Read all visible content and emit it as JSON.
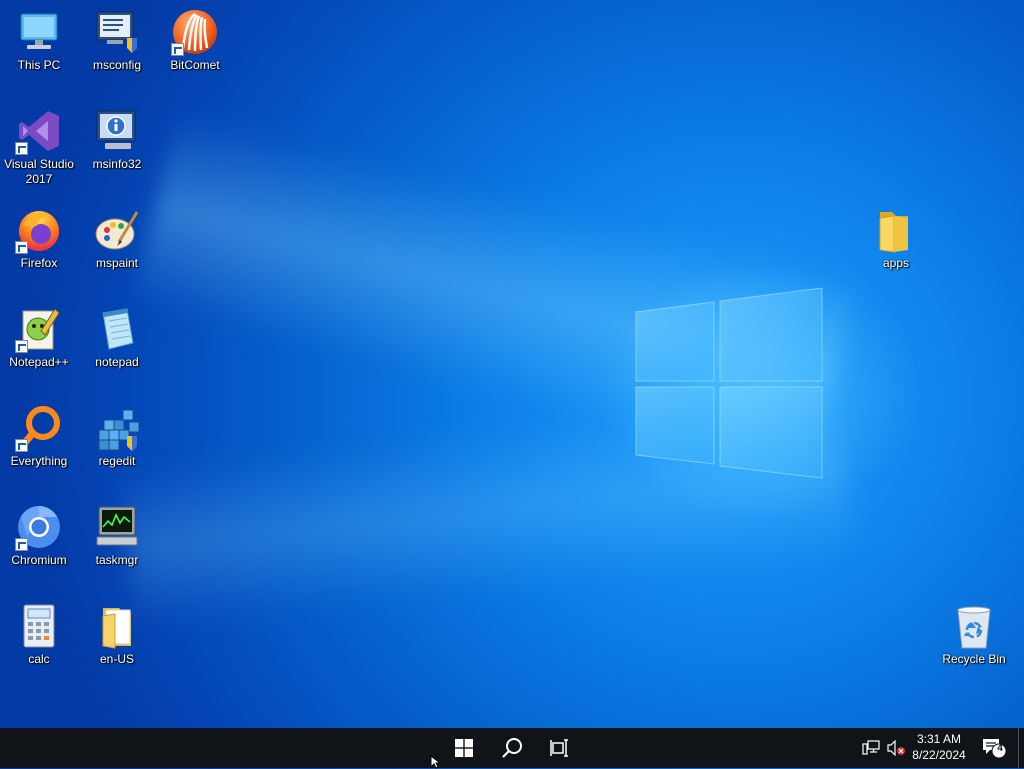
{
  "desktop": {
    "icons": [
      {
        "label": "This PC",
        "icon": "computer-icon"
      },
      {
        "label": "msconfig",
        "icon": "msconfig-icon"
      },
      {
        "label": "BitComet",
        "icon": "bitcomet-icon"
      },
      {
        "label": "Visual Studio 2017",
        "icon": "visual-studio-icon"
      },
      {
        "label": "msinfo32",
        "icon": "msinfo32-icon"
      },
      {
        "label": "Firefox",
        "icon": "firefox-icon"
      },
      {
        "label": "mspaint",
        "icon": "mspaint-icon"
      },
      {
        "label": "Notepad++",
        "icon": "notepad-plus-plus-icon"
      },
      {
        "label": "notepad",
        "icon": "notepad-icon"
      },
      {
        "label": "Everything",
        "icon": "everything-search-icon"
      },
      {
        "label": "regedit",
        "icon": "regedit-icon"
      },
      {
        "label": "Chromium",
        "icon": "chromium-icon"
      },
      {
        "label": "taskmgr",
        "icon": "taskmgr-icon"
      },
      {
        "label": "calc",
        "icon": "calculator-icon"
      },
      {
        "label": "en-US",
        "icon": "folder-icon"
      },
      {
        "label": "apps",
        "icon": "folder-icon"
      },
      {
        "label": "Recycle Bin",
        "icon": "recycle-bin-icon"
      }
    ]
  },
  "taskbar": {
    "start": "start-windows-icon",
    "search": "search-icon",
    "task_view": "task-view-icon",
    "tray": {
      "network": "network-icon",
      "volume": "volume-muted-icon",
      "time": "3:31 AM",
      "date": "8/22/2024",
      "notifications_count": "4"
    }
  },
  "colors": {
    "taskbar": "#101418",
    "desktop_accent": "#0c7fe8"
  }
}
